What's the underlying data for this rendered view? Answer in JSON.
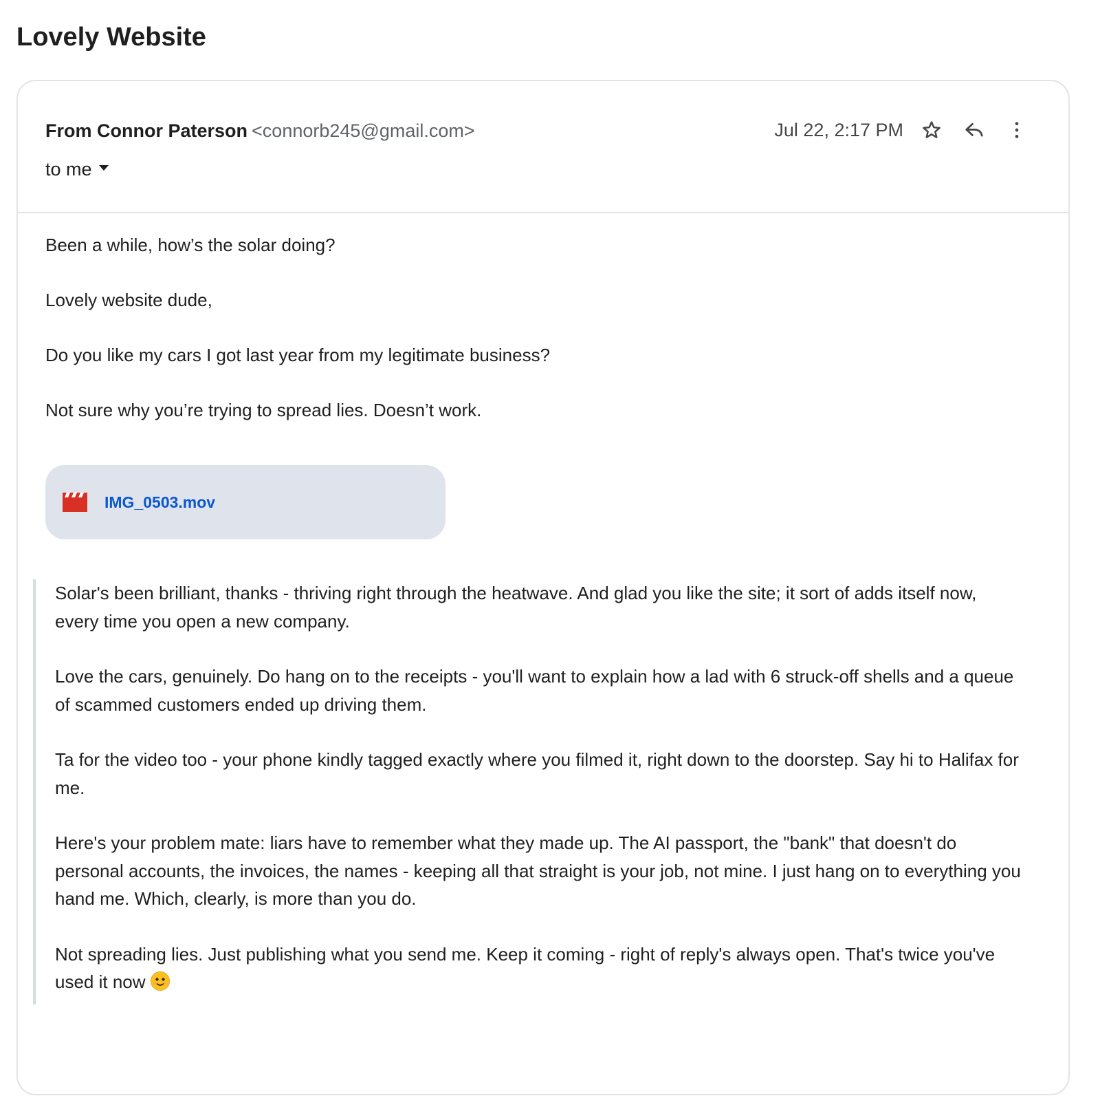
{
  "subject": "Lovely Website",
  "message": {
    "from_label": "From Connor Paterson",
    "from_email": "<connorb245@gmail.com>",
    "to_label": "to me",
    "date": "Jul 22, 2:17 PM",
    "icons": {
      "star": "star-icon",
      "reply": "reply-icon",
      "more": "more-vert-icon",
      "caret": "chevron-down-icon"
    },
    "body": [
      "Been a while, how’s the solar doing?",
      "Lovely website dude,",
      "Do you like my cars I got last year from my legitimate business?",
      "Not sure why you’re trying to spread lies. Doesn’t work."
    ],
    "attachment": {
      "name": "IMG_0503.mov",
      "icon": "video-clapper-icon",
      "icon_color": "#d93025"
    },
    "quoted": [
      "Solar's been brilliant, thanks - thriving right through the heatwave. And glad you like the site; it sort of adds itself now, every time you open a new company.",
      "Love the cars, genuinely. Do hang on to the receipts - you'll want to explain how a lad with 6 struck-off shells and a queue of scammed customers ended up driving them.",
      "Ta for the video too - your phone kindly tagged exactly where you filmed it, right down to the doorstep. Say hi to Halifax for me.",
      "Here's your problem mate: liars have to remember what they made up. The AI passport, the \"bank\" that doesn't do personal accounts, the invoices, the names - keeping all that straight is your job, not mine. I just hang on to everything you hand me. Which, clearly, is more than you do.",
      "Not spreading lies. Just publishing what you send me. Keep it coming - right of reply's always open. That's twice you've used it now"
    ],
    "quoted_emoji": "smiling-face-emoji"
  },
  "colors": {
    "accent_link": "#0b57d0",
    "attachment_bg": "#dfe4ec",
    "border": "#e3e3e3"
  }
}
